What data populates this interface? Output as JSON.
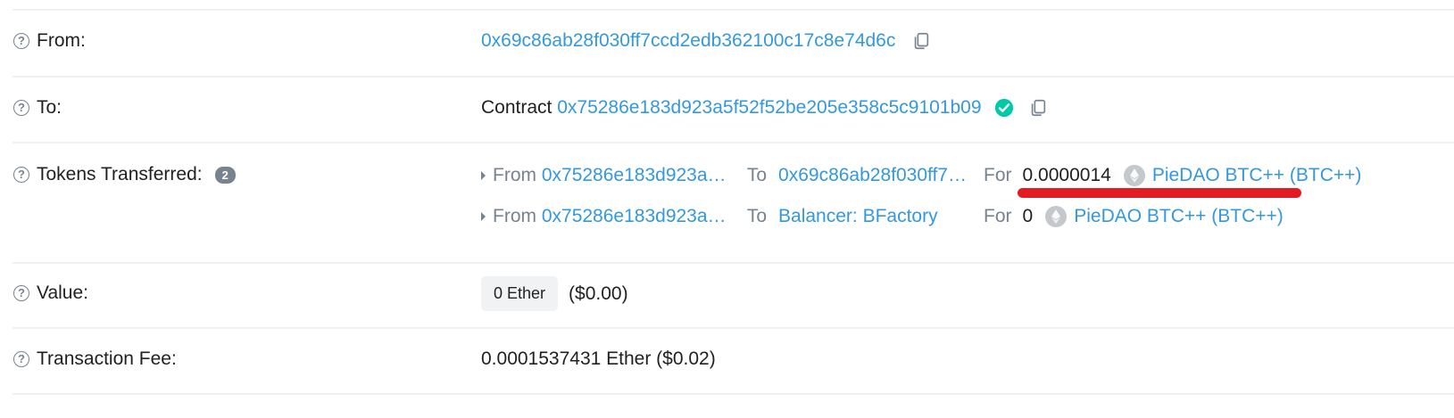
{
  "from": {
    "label": "From:",
    "address": "0x69c86ab28f030ff7ccd2edb362100c17c8e74d6c"
  },
  "to": {
    "label": "To:",
    "prefix": "Contract",
    "address": "0x75286e183d923a5f52f52be205e358c5c9101b09"
  },
  "tokens": {
    "label": "Tokens Transferred:",
    "count": "2",
    "transfers": [
      {
        "from_word": "From",
        "from": "0x75286e183d923a…",
        "to_word": "To",
        "to": "0x69c86ab28f030ff7…",
        "for_word": "For",
        "amount": "0.0000014",
        "token": "PieDAO BTC++ (BTC++)"
      },
      {
        "from_word": "From",
        "from": "0x75286e183d923a…",
        "to_word": "To",
        "to": "Balancer: BFactory",
        "for_word": "For",
        "amount": "0",
        "token": "PieDAO BTC++ (BTC++)"
      }
    ]
  },
  "value": {
    "label": "Value:",
    "amount": "0 Ether",
    "usd": "($0.00)"
  },
  "fee": {
    "label": "Transaction Fee:",
    "amount": "0.0001537431 Ether ($0.02)"
  },
  "colors": {
    "link": "#3498db",
    "muted": "#77838f",
    "highlight": "#e31b23",
    "check": "#00c9a7"
  },
  "icons": [
    "help-icon",
    "copy-icon",
    "verified-check-icon",
    "ether-token-icon",
    "expand-caret-icon"
  ]
}
